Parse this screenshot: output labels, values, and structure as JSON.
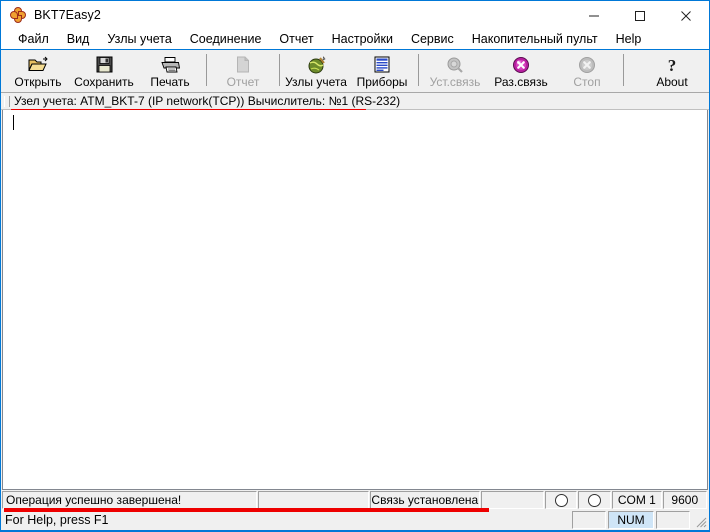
{
  "window": {
    "title": "BKT7Easy2",
    "icon": "flower-app-icon",
    "controls": {
      "minimize": "minimize-icon",
      "maximize": "maximize-icon",
      "close": "close-icon"
    },
    "accent_color": "#0078d7"
  },
  "menu": {
    "items": [
      {
        "label": "Файл"
      },
      {
        "label": "Вид"
      },
      {
        "label": "Узлы учета"
      },
      {
        "label": "Соединение"
      },
      {
        "label": "Отчет"
      },
      {
        "label": "Настройки"
      },
      {
        "label": "Сервис"
      },
      {
        "label": "Накопительный пульт"
      },
      {
        "label": "Help"
      }
    ]
  },
  "toolbar": {
    "buttons": [
      {
        "label": "Открыть",
        "icon": "open-folder-icon",
        "enabled": true
      },
      {
        "label": "Сохранить",
        "icon": "floppy-save-icon",
        "enabled": true
      },
      {
        "label": "Печать",
        "icon": "printer-icon",
        "enabled": true
      },
      {
        "label": "Отчет",
        "icon": "document-icon",
        "enabled": false
      },
      {
        "label": "Узлы учета",
        "icon": "globe-icon",
        "enabled": true
      },
      {
        "label": "Приборы",
        "icon": "device-list-icon",
        "enabled": true
      },
      {
        "label": "Уст.связь",
        "icon": "connect-search-icon",
        "enabled": false
      },
      {
        "label": "Раз.связь",
        "icon": "disconnect-x-icon",
        "enabled": true
      },
      {
        "label": "Стоп",
        "icon": "stop-x-icon",
        "enabled": false
      },
      {
        "label": "About",
        "icon": "help-question-icon",
        "enabled": true
      }
    ]
  },
  "infobar": {
    "text": "Узел учета: ATM_BKT-7   (IP network(TCP)) Вычислитель: №1 (RS-232)",
    "underline_color": "#ee0000"
  },
  "statusbar": {
    "message": "Операция успешно завершена!",
    "connection": "Связь установлена",
    "port": "COM 1",
    "baud": "9600",
    "led_rx": "led-indicator",
    "led_tx": "led-indicator",
    "underline_color": "#ee0000"
  },
  "statusbar2": {
    "hint": "For Help, press F1",
    "num": "NUM"
  }
}
